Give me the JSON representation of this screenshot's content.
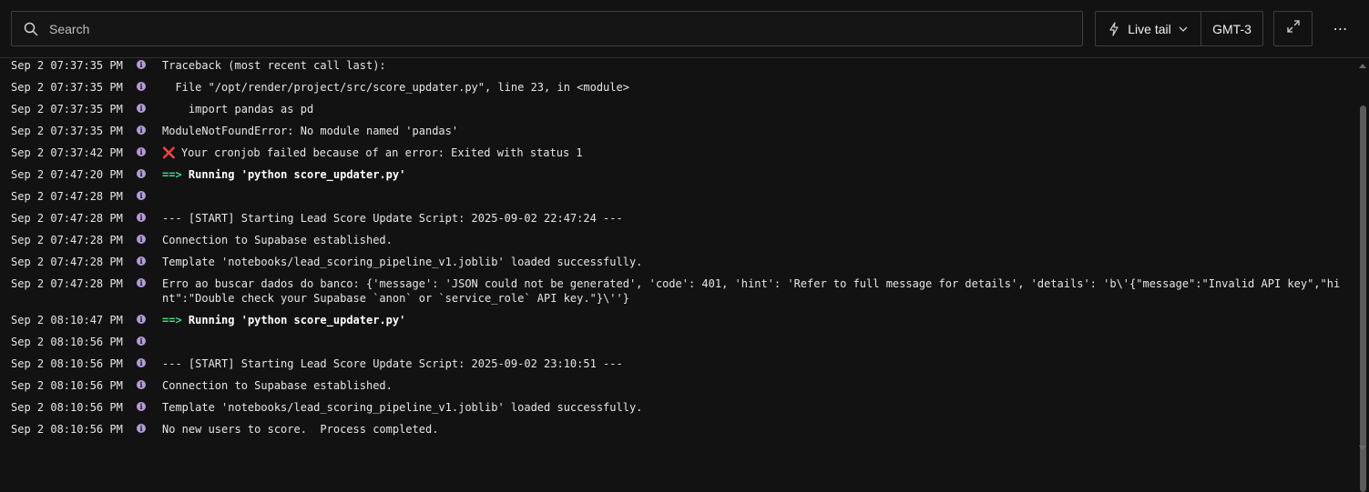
{
  "toolbar": {
    "search_placeholder": "Search",
    "live_tail_label": "Live tail",
    "timezone_label": "GMT-3",
    "more_label": "⋯"
  },
  "colors": {
    "background": "#121212",
    "info_icon": "#b69bd9",
    "arrow": "#3ddc84",
    "error_x": "#e5484d"
  },
  "logs": [
    {
      "ts": "Sep 2 07:37:35 PM",
      "msg": "Traceback (most recent call last):"
    },
    {
      "ts": "Sep 2 07:37:35 PM",
      "msg": "  File \"/opt/render/project/src/score_updater.py\", line 23, in <module>"
    },
    {
      "ts": "Sep 2 07:37:35 PM",
      "msg": "    import pandas as pd"
    },
    {
      "ts": "Sep 2 07:37:35 PM",
      "msg": "ModuleNotFoundError: No module named 'pandas'"
    },
    {
      "ts": "Sep 2 07:37:42 PM",
      "icon": "❌",
      "msg": "Your cronjob failed because of an error: Exited with status 1"
    },
    {
      "ts": "Sep 2 07:47:20 PM",
      "arrow": "==>",
      "msg": "Running 'python score_updater.py'"
    },
    {
      "ts": "Sep 2 07:47:28 PM",
      "msg": ""
    },
    {
      "ts": "Sep 2 07:47:28 PM",
      "msg": "--- [START] Starting Lead Score Update Script: 2025-09-02 22:47:24 ---"
    },
    {
      "ts": "Sep 2 07:47:28 PM",
      "msg": "Connection to Supabase established."
    },
    {
      "ts": "Sep 2 07:47:28 PM",
      "msg": "Template 'notebooks/lead_scoring_pipeline_v1.joblib' loaded successfully."
    },
    {
      "ts": "Sep 2 07:47:28 PM",
      "msg": "Erro ao buscar dados do banco: {'message': 'JSON could not be generated', 'code': 401, 'hint': 'Refer to full message for details', 'details': 'b\\'{\"message\":\"Invalid API key\",\"hint\":\"Double check your Supabase `anon` or `service_role` API key.\"}\\''}"
    },
    {
      "ts": "Sep 2 08:10:47 PM",
      "arrow": "==>",
      "msg": "Running 'python score_updater.py'"
    },
    {
      "ts": "Sep 2 08:10:56 PM",
      "msg": ""
    },
    {
      "ts": "Sep 2 08:10:56 PM",
      "msg": "--- [START] Starting Lead Score Update Script: 2025-09-02 23:10:51 ---"
    },
    {
      "ts": "Sep 2 08:10:56 PM",
      "msg": "Connection to Supabase established."
    },
    {
      "ts": "Sep 2 08:10:56 PM",
      "msg": "Template 'notebooks/lead_scoring_pipeline_v1.joblib' loaded successfully."
    },
    {
      "ts": "Sep 2 08:10:56 PM",
      "msg": "No new users to score.  Process completed."
    }
  ]
}
